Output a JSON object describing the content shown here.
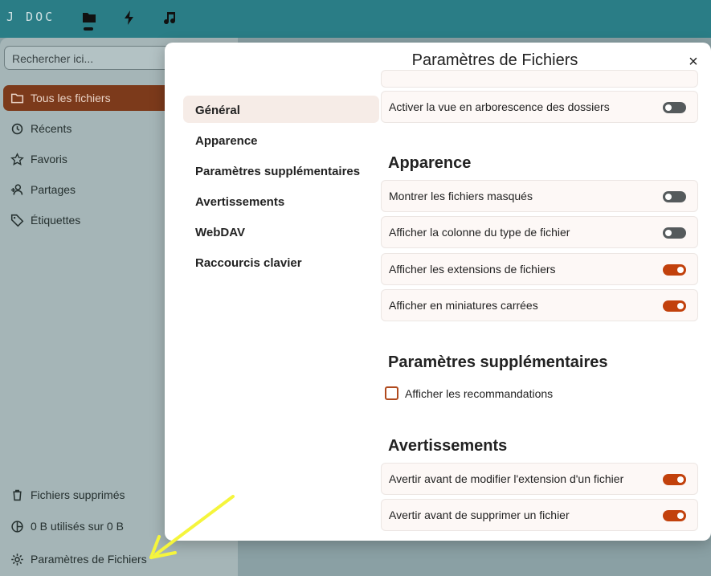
{
  "topbar": {
    "logo": "J DOC",
    "apps": [
      {
        "name": "files",
        "icon": "folder-icon"
      },
      {
        "name": "activity",
        "icon": "lightning-icon"
      },
      {
        "name": "music",
        "icon": "music-note-icon"
      }
    ]
  },
  "sidebar": {
    "search_placeholder": "Rechercher ici...",
    "items": [
      {
        "label": "Tous les fichiers",
        "icon": "folder-icon",
        "active": true
      },
      {
        "label": "Récents",
        "icon": "history-icon"
      },
      {
        "label": "Favoris",
        "icon": "star-icon"
      },
      {
        "label": "Partages",
        "icon": "share-user-icon"
      },
      {
        "label": "Étiquettes",
        "icon": "tag-icon"
      }
    ],
    "footer": {
      "trash": "Fichiers supprimés",
      "quota": "0 B utilisés sur 0 B",
      "settings": "Paramètres de Fichiers"
    }
  },
  "modal": {
    "title": "Paramètres de Fichiers",
    "close_label": "×",
    "tabs": [
      {
        "label": "Général",
        "active": true
      },
      {
        "label": "Apparence"
      },
      {
        "label": "Paramètres supplémentaires"
      },
      {
        "label": "Avertissements"
      },
      {
        "label": "WebDAV"
      },
      {
        "label": "Raccourcis clavier"
      }
    ],
    "general": {
      "tree_view": {
        "label": "Activer la vue en arborescence des dossiers",
        "enabled": false
      }
    },
    "appearance": {
      "title": "Apparence",
      "hidden_files": {
        "label": "Montrer les fichiers masqués",
        "enabled": false
      },
      "file_type_column": {
        "label": "Afficher la colonne du type de fichier",
        "enabled": false
      },
      "file_extensions": {
        "label": "Afficher les extensions de fichiers",
        "enabled": true
      },
      "square_thumbnails": {
        "label": "Afficher en miniatures carrées",
        "enabled": true
      }
    },
    "additional": {
      "title": "Paramètres supplémentaires",
      "recommendations": {
        "label": "Afficher les recommandations",
        "checked": false
      }
    },
    "warnings": {
      "title": "Avertissements",
      "extension_change": {
        "label": "Avertir avant de modifier l'extension d'un fichier",
        "enabled": true
      },
      "delete_file": {
        "label": "Avertir avant de supprimer un fichier",
        "enabled": true
      }
    }
  },
  "colors": {
    "topbar": "#2a7d86",
    "accent": "#c2410c",
    "active_nav": "#7c3a1b",
    "annotation_arrow": "#f5f53c"
  }
}
